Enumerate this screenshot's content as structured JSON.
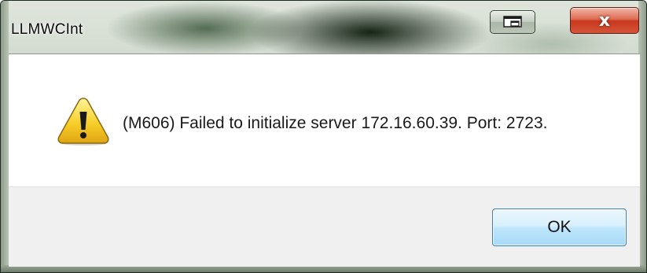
{
  "window": {
    "title": "LLMWCInt",
    "restore_icon": "restore-window-icon",
    "close_label": "x",
    "close_icon": "close-icon"
  },
  "dialog": {
    "icon": "warning-icon",
    "message": "(M606) Failed to initialize server 172.16.60.39. Port: 2723.",
    "ok_label": "OK"
  },
  "colors": {
    "close_button": "#c8381d",
    "ok_button_border": "#3c7fb1",
    "warning_fill": "#f7cf2a",
    "button_area": "#f0f0f0"
  }
}
